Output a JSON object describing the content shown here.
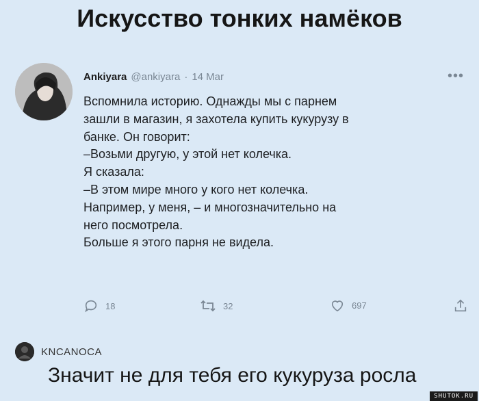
{
  "title": "Искусство тонких намёков",
  "tweet": {
    "author_name": "Ankiyara",
    "handle": "@ankiyara",
    "separator": "·",
    "date": "14 Mar",
    "body_lines": [
      "Вспомнила историю. Однажды мы с парнем",
      "зашли в магазин, я захотела купить кукурузу в",
      "банке. Он говорит:",
      "–Возьми другую, у этой нет колечка.",
      "Я сказала:",
      "–В этом мире много у кого нет колечка.",
      "Например, у меня, – и многозначительно на",
      "него посмотрела.",
      "Больше я этого парня не видела."
    ],
    "stats": {
      "replies": "18",
      "retweets": "32",
      "likes": "697"
    }
  },
  "comment": {
    "author": "KNCANOCA",
    "text": "Значит не для тебя его кукуруза росла"
  },
  "watermark": "SHUTOK.RU",
  "icons": [
    "more-icon",
    "reply-icon",
    "retweet-icon",
    "like-icon",
    "share-icon",
    "avatar"
  ],
  "colors": {
    "background": "#dbe9f6",
    "muted": "#7a8794",
    "text": "#1d1f22"
  }
}
